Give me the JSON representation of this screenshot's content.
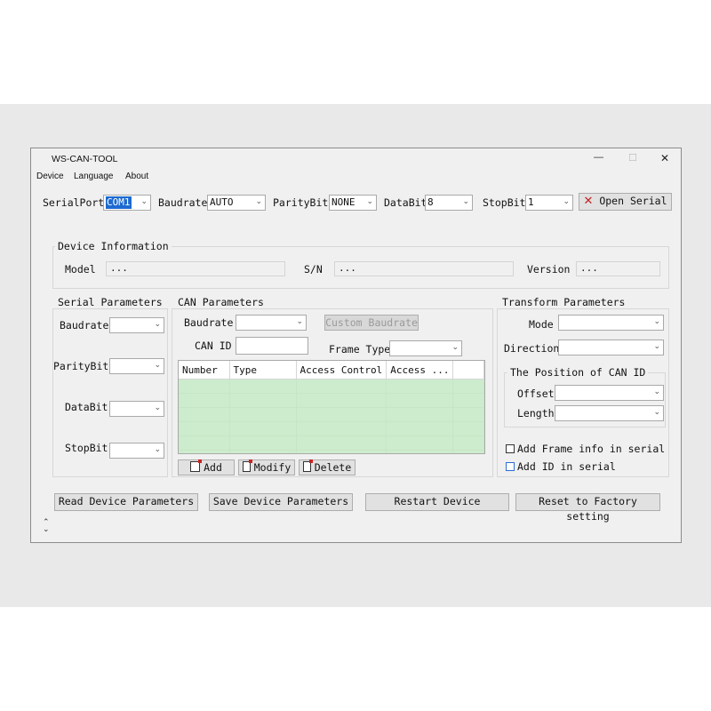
{
  "window": {
    "title": "WS-CAN-TOOL",
    "controls": {
      "minimize": "—",
      "maximize": "☐",
      "close": "✕"
    }
  },
  "menu": [
    "Device",
    "Language",
    "About"
  ],
  "toolbar": {
    "serialport_label": "SerialPort",
    "serialport_value": "COM1",
    "baudrate_label": "Baudrate",
    "baudrate_value": "AUTO",
    "paritybit_label": "ParityBit",
    "paritybit_value": "NONE",
    "databit_label": "DataBit",
    "databit_value": "8",
    "stopbit_label": "StopBit",
    "stopbit_value": "1",
    "open_serial_label": "Open Serial",
    "open_serial_icon": "red-x-icon"
  },
  "device_info": {
    "title": "Device Information",
    "model_label": "Model",
    "model_value": "...",
    "sn_label": "S/N",
    "sn_value": "...",
    "version_label": "Version",
    "version_value": "..."
  },
  "serial_params": {
    "title": "Serial Parameters",
    "baudrate_label": "Baudrate",
    "paritybit_label": "ParityBit",
    "databit_label": "DataBit",
    "stopbit_label": "StopBit"
  },
  "can_params": {
    "title": "CAN Parameters",
    "baudrate_label": "Baudrate",
    "custom_baudrate_label": "Custom Baudrate",
    "can_id_label": "CAN ID",
    "frame_type_label": "Frame Type",
    "table_headers": [
      "Number",
      "Type",
      "Access Control",
      "Access ..."
    ],
    "add_label": "Add",
    "modify_label": "Modify",
    "delete_label": "Delete"
  },
  "transform_params": {
    "title": "Transform Parameters",
    "mode_label": "Mode",
    "direction_label": "Direction",
    "canid_position_title": "The Position of CAN ID",
    "offset_label": "Offset",
    "length_label": "Length",
    "add_frame_info_label": "Add Frame info in serial",
    "add_id_label": "Add ID in serial"
  },
  "actions": {
    "read_label": "Read Device Parameters",
    "save_label": "Save Device Parameters",
    "restart_label": "Restart Device",
    "reset_label": "Reset to Factory setting"
  },
  "colors": {
    "grid_green": "#cdeccd",
    "selection_blue": "#1d6ad1",
    "close_red": "#c22222"
  }
}
